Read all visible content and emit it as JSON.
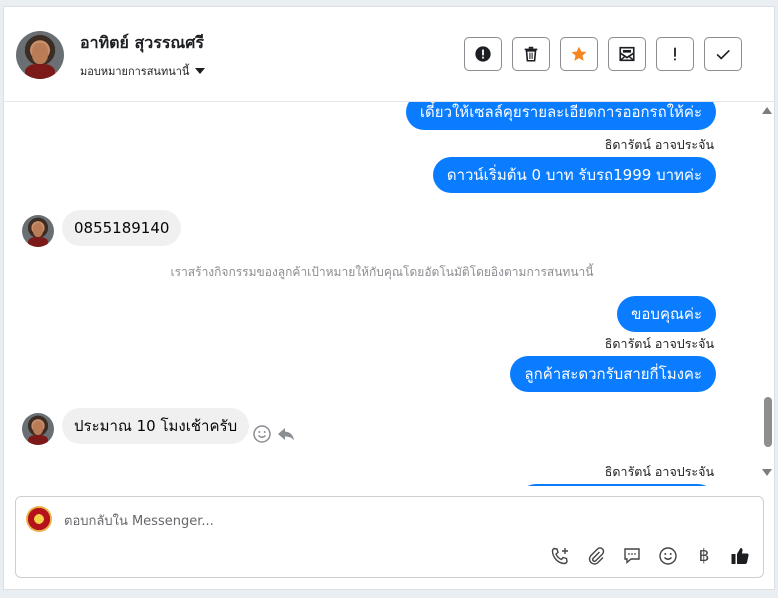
{
  "header": {
    "contact_name": "อาทิตย์ สุวรรณศรี",
    "assign_label": "มอบหมายการสนทนานี้"
  },
  "messages": {
    "out1": "เดี๋ยวให้เซลล์คุยรายละเอียดการออกรถให้ค่ะ",
    "sender1": "ธิดารัตน์ อาจประจัน",
    "out2": "ดาวน์เริ่มต้น 0 บาท รับรถ1999 บาทค่ะ",
    "in1": "0855189140",
    "system": "เราสร้างกิจกรรมของลูกค้าเป้าหมายให้กับคุณโดยอัตโนมัติโดยอิงตามการสนทนานี้",
    "out3": "ขอบคุณค่ะ",
    "sender2": "ธิดารัตน์ อาจประจัน",
    "out4": "ลูกค้าสะดวกรับสายกี่โมงคะ",
    "in2": "ประมาณ 10 โมงเช้าครับ",
    "sender3": "ธิดารัตน์ อาจประจัน"
  },
  "composer": {
    "placeholder": "ตอบกลับใน Messenger...",
    "baht_symbol": "฿"
  },
  "colors": {
    "accent": "#0a7cff",
    "star": "#f5861f",
    "incoming_bubble": "#f0f0f0"
  }
}
